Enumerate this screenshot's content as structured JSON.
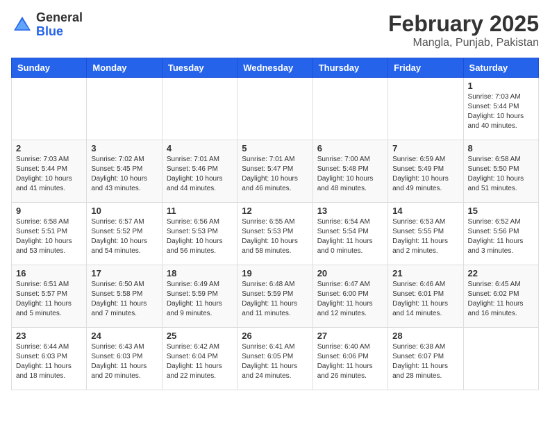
{
  "header": {
    "logo_general": "General",
    "logo_blue": "Blue",
    "title": "February 2025",
    "subtitle": "Mangla, Punjab, Pakistan"
  },
  "weekdays": [
    "Sunday",
    "Monday",
    "Tuesday",
    "Wednesday",
    "Thursday",
    "Friday",
    "Saturday"
  ],
  "weeks": [
    [
      {
        "day": "",
        "info": ""
      },
      {
        "day": "",
        "info": ""
      },
      {
        "day": "",
        "info": ""
      },
      {
        "day": "",
        "info": ""
      },
      {
        "day": "",
        "info": ""
      },
      {
        "day": "",
        "info": ""
      },
      {
        "day": "1",
        "info": "Sunrise: 7:03 AM\nSunset: 5:44 PM\nDaylight: 10 hours and 40 minutes."
      }
    ],
    [
      {
        "day": "2",
        "info": "Sunrise: 7:03 AM\nSunset: 5:44 PM\nDaylight: 10 hours and 41 minutes."
      },
      {
        "day": "3",
        "info": "Sunrise: 7:02 AM\nSunset: 5:45 PM\nDaylight: 10 hours and 43 minutes."
      },
      {
        "day": "4",
        "info": "Sunrise: 7:01 AM\nSunset: 5:46 PM\nDaylight: 10 hours and 44 minutes."
      },
      {
        "day": "5",
        "info": "Sunrise: 7:01 AM\nSunset: 5:47 PM\nDaylight: 10 hours and 46 minutes."
      },
      {
        "day": "6",
        "info": "Sunrise: 7:00 AM\nSunset: 5:48 PM\nDaylight: 10 hours and 48 minutes."
      },
      {
        "day": "7",
        "info": "Sunrise: 6:59 AM\nSunset: 5:49 PM\nDaylight: 10 hours and 49 minutes."
      },
      {
        "day": "8",
        "info": "Sunrise: 6:58 AM\nSunset: 5:50 PM\nDaylight: 10 hours and 51 minutes."
      }
    ],
    [
      {
        "day": "9",
        "info": "Sunrise: 6:58 AM\nSunset: 5:51 PM\nDaylight: 10 hours and 53 minutes."
      },
      {
        "day": "10",
        "info": "Sunrise: 6:57 AM\nSunset: 5:52 PM\nDaylight: 10 hours and 54 minutes."
      },
      {
        "day": "11",
        "info": "Sunrise: 6:56 AM\nSunset: 5:53 PM\nDaylight: 10 hours and 56 minutes."
      },
      {
        "day": "12",
        "info": "Sunrise: 6:55 AM\nSunset: 5:53 PM\nDaylight: 10 hours and 58 minutes."
      },
      {
        "day": "13",
        "info": "Sunrise: 6:54 AM\nSunset: 5:54 PM\nDaylight: 11 hours and 0 minutes."
      },
      {
        "day": "14",
        "info": "Sunrise: 6:53 AM\nSunset: 5:55 PM\nDaylight: 11 hours and 2 minutes."
      },
      {
        "day": "15",
        "info": "Sunrise: 6:52 AM\nSunset: 5:56 PM\nDaylight: 11 hours and 3 minutes."
      }
    ],
    [
      {
        "day": "16",
        "info": "Sunrise: 6:51 AM\nSunset: 5:57 PM\nDaylight: 11 hours and 5 minutes."
      },
      {
        "day": "17",
        "info": "Sunrise: 6:50 AM\nSunset: 5:58 PM\nDaylight: 11 hours and 7 minutes."
      },
      {
        "day": "18",
        "info": "Sunrise: 6:49 AM\nSunset: 5:59 PM\nDaylight: 11 hours and 9 minutes."
      },
      {
        "day": "19",
        "info": "Sunrise: 6:48 AM\nSunset: 5:59 PM\nDaylight: 11 hours and 11 minutes."
      },
      {
        "day": "20",
        "info": "Sunrise: 6:47 AM\nSunset: 6:00 PM\nDaylight: 11 hours and 12 minutes."
      },
      {
        "day": "21",
        "info": "Sunrise: 6:46 AM\nSunset: 6:01 PM\nDaylight: 11 hours and 14 minutes."
      },
      {
        "day": "22",
        "info": "Sunrise: 6:45 AM\nSunset: 6:02 PM\nDaylight: 11 hours and 16 minutes."
      }
    ],
    [
      {
        "day": "23",
        "info": "Sunrise: 6:44 AM\nSunset: 6:03 PM\nDaylight: 11 hours and 18 minutes."
      },
      {
        "day": "24",
        "info": "Sunrise: 6:43 AM\nSunset: 6:03 PM\nDaylight: 11 hours and 20 minutes."
      },
      {
        "day": "25",
        "info": "Sunrise: 6:42 AM\nSunset: 6:04 PM\nDaylight: 11 hours and 22 minutes."
      },
      {
        "day": "26",
        "info": "Sunrise: 6:41 AM\nSunset: 6:05 PM\nDaylight: 11 hours and 24 minutes."
      },
      {
        "day": "27",
        "info": "Sunrise: 6:40 AM\nSunset: 6:06 PM\nDaylight: 11 hours and 26 minutes."
      },
      {
        "day": "28",
        "info": "Sunrise: 6:38 AM\nSunset: 6:07 PM\nDaylight: 11 hours and 28 minutes."
      },
      {
        "day": "",
        "info": ""
      }
    ]
  ]
}
